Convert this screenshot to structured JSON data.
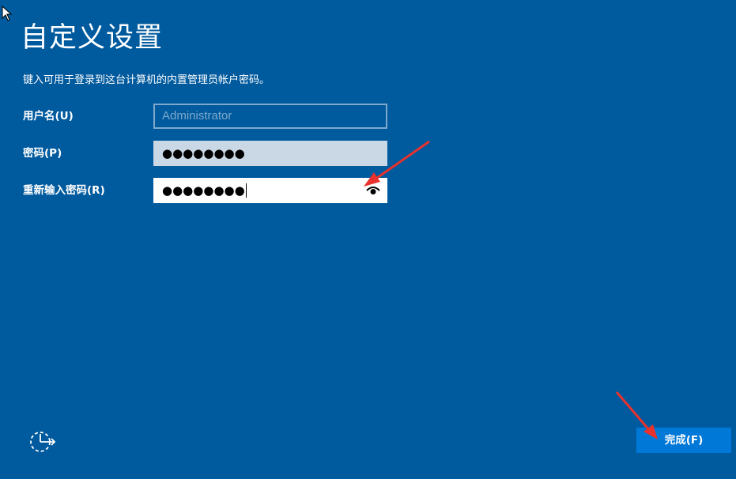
{
  "page": {
    "title": "自定义设置",
    "instruction": "键入可用于登录到这台计算机的内置管理员帐户密码。"
  },
  "form": {
    "username": {
      "label": "用户名(U)",
      "value": "Administrator"
    },
    "password": {
      "label": "密码(P)",
      "value": "●●●●●●●●"
    },
    "reenter_password": {
      "label": "重新输入密码(R)",
      "value": "●●●●●●●●",
      "reveal_icon": "eye-icon"
    }
  },
  "footer": {
    "accessibility_icon": "ease-of-access-icon",
    "finish_label": "完成(F)"
  },
  "colors": {
    "background": "#005a9e",
    "button": "#0078d7",
    "annotation": "#e8322d"
  }
}
